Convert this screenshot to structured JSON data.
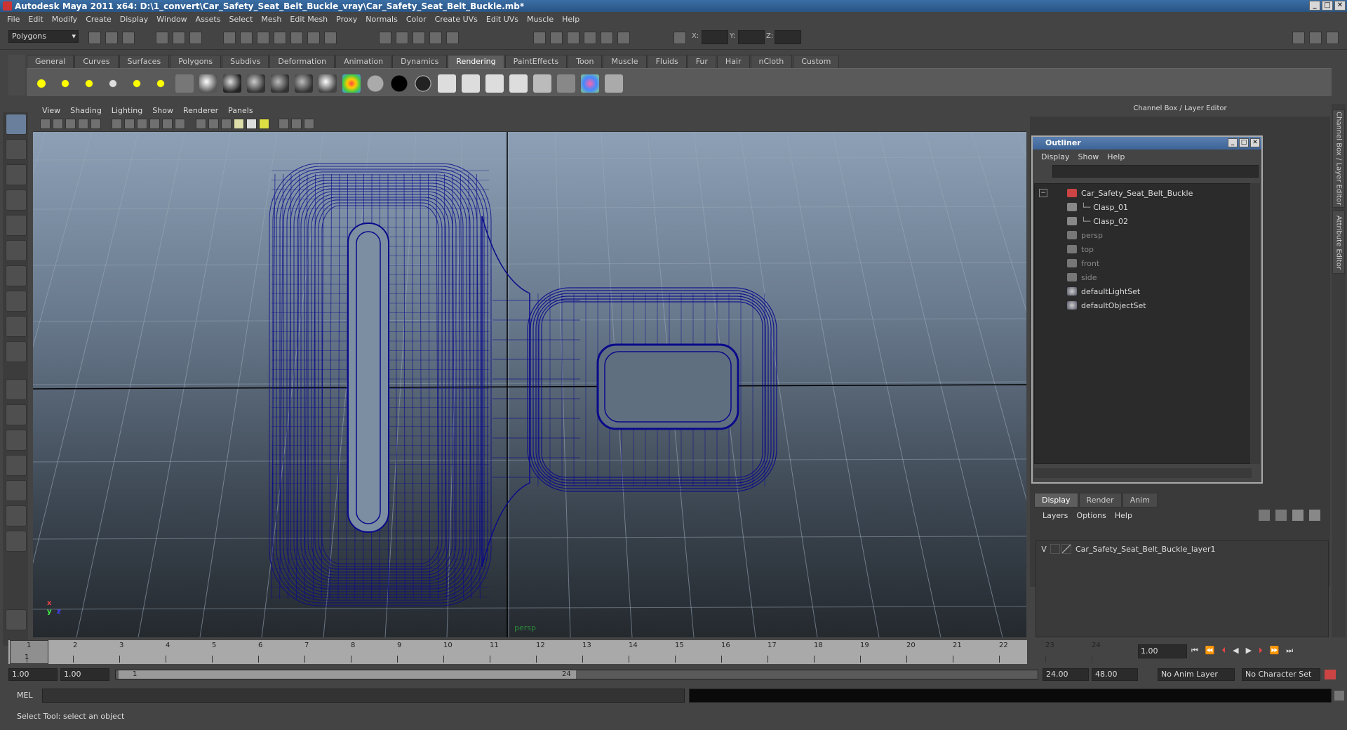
{
  "window": {
    "title": "Autodesk Maya 2011 x64: D:\\1_convert\\Car_Safety_Seat_Belt_Buckle_vray\\Car_Safety_Seat_Belt_Buckle.mb*"
  },
  "menubar": [
    "File",
    "Edit",
    "Modify",
    "Create",
    "Display",
    "Window",
    "Assets",
    "Select",
    "Mesh",
    "Edit Mesh",
    "Proxy",
    "Normals",
    "Color",
    "Create UVs",
    "Edit UVs",
    "Muscle",
    "Help"
  ],
  "statusline": {
    "mode": "Polygons",
    "x_label": "X:",
    "y_label": "Y:",
    "z_label": "Z:"
  },
  "shelf": {
    "tabs": [
      "General",
      "Curves",
      "Surfaces",
      "Polygons",
      "Subdivs",
      "Deformation",
      "Animation",
      "Dynamics",
      "Rendering",
      "PaintEffects",
      "Toon",
      "Muscle",
      "Fluids",
      "Fur",
      "Hair",
      "nCloth",
      "Custom"
    ],
    "active_tab": "Rendering"
  },
  "viewport": {
    "menu": [
      "View",
      "Shading",
      "Lighting",
      "Show",
      "Renderer",
      "Panels"
    ],
    "camera_label": "persp",
    "axis": {
      "x": "x",
      "y": "y",
      "z": "z"
    },
    "colors": {
      "wire": "#0a0a8a",
      "axis_x": "#e44444",
      "axis_y": "#44ee44",
      "axis_z": "#4444ff"
    }
  },
  "channel_box": {
    "title": "Channel Box / Layer Editor"
  },
  "side_tabs": [
    "Channel Box / Layer Editor",
    "Attribute Editor"
  ],
  "outliner": {
    "title": "Outliner",
    "menu": [
      "Display",
      "Show",
      "Help"
    ],
    "items": [
      {
        "label": "Car_Safety_Seat_Belt_Buckle",
        "icon": "group-icon",
        "dim": false
      },
      {
        "label": "Clasp_01",
        "icon": "mesh-icon",
        "dim": false
      },
      {
        "label": "Clasp_02",
        "icon": "mesh-icon",
        "dim": false
      },
      {
        "label": "persp",
        "icon": "camera-icon",
        "dim": true
      },
      {
        "label": "top",
        "icon": "camera-icon",
        "dim": true
      },
      {
        "label": "front",
        "icon": "camera-icon",
        "dim": true
      },
      {
        "label": "side",
        "icon": "camera-icon",
        "dim": true
      },
      {
        "label": "defaultLightSet",
        "icon": "set-icon",
        "dim": false
      },
      {
        "label": "defaultObjectSet",
        "icon": "set-icon",
        "dim": false
      }
    ]
  },
  "layer_editor": {
    "tabs": [
      "Display",
      "Render",
      "Anim"
    ],
    "active_tab": "Display",
    "menu": [
      "Layers",
      "Options",
      "Help"
    ],
    "layers": [
      {
        "visible": "V",
        "name": "Car_Safety_Seat_Belt_Buckle_layer1"
      }
    ]
  },
  "timeslider": {
    "ticks": [
      "1",
      "2",
      "3",
      "4",
      "5",
      "6",
      "7",
      "8",
      "9",
      "10",
      "11",
      "12",
      "13",
      "14",
      "15",
      "16",
      "17",
      "18",
      "19",
      "20",
      "21",
      "22",
      "23",
      "24"
    ],
    "current_frame": "1",
    "current_field": "1.00"
  },
  "range": {
    "start_time": "1.00",
    "playback_start": "1.00",
    "range_start": "1",
    "range_end": "24",
    "playback_end": "24.00",
    "end_time": "48.00",
    "anim_layer": "No Anim Layer",
    "character_set": "No Character Set"
  },
  "cmdline": {
    "label": "MEL"
  },
  "helpline": {
    "text": "Select Tool: select an object"
  }
}
